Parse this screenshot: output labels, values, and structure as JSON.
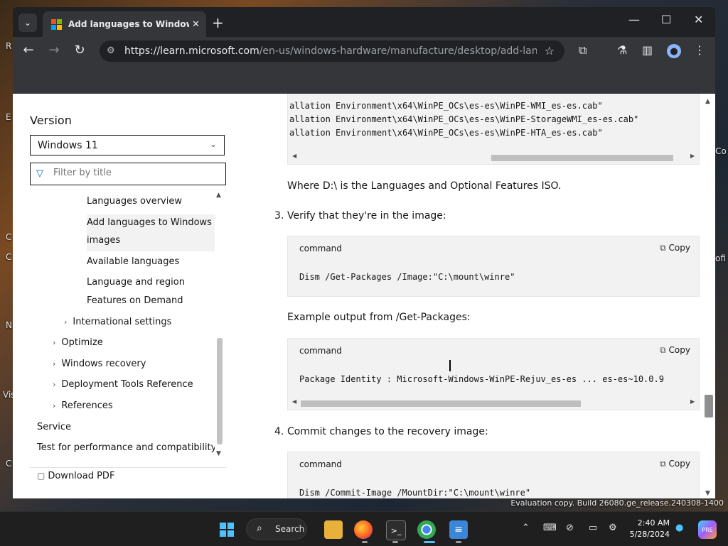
{
  "desktop": {
    "edge_texts": [
      "R",
      "E",
      "C",
      "N",
      "Vis",
      "C",
      "C",
      "Co",
      "ofi"
    ],
    "watermark": "Evaluation copy. Build 26080.ge_release.240308-1400"
  },
  "browser": {
    "tab_title": "Add languages to Windows im",
    "tab_close": "✕",
    "new_tab": "+",
    "url_domain": "https://learn.microsoft.com",
    "url_path": "/en-us/windows-hardware/manufacture/desktop/add-language-...",
    "icons": {
      "tab_menu": "chevron-down-icon",
      "back": "←",
      "forward": "→",
      "reload": "↻",
      "star": "☆",
      "minimize": "—",
      "maximize": "☐",
      "close": "✕"
    }
  },
  "sidebar": {
    "version_label": "Version",
    "version_value": "Windows 11",
    "filter_placeholder": "Filter by title",
    "toc": [
      {
        "label": "Languages overview"
      },
      {
        "label": "Add languages to Windows"
      },
      {
        "label": "images"
      },
      {
        "label": "Available languages"
      },
      {
        "label": "Language and region"
      },
      {
        "label": "Features on Demand"
      },
      {
        "label": "International settings"
      },
      {
        "label": "Optimize"
      },
      {
        "label": "Windows recovery"
      },
      {
        "label": "Deployment Tools Reference"
      },
      {
        "label": "References"
      },
      {
        "label": "Service"
      },
      {
        "label": "Test for performance and compatibility"
      }
    ],
    "download_pdf": "Download PDF"
  },
  "content": {
    "top_code_lines": [
      "allation Environment\\x64\\WinPE_OCs\\es-es\\WinPE-WMI_es-es.cab\"",
      "allation Environment\\x64\\WinPE_OCs\\es-es\\WinPE-StorageWMI_es-es.cab\"",
      "allation Environment\\x64\\WinPE_OCs\\es-es\\WinPE-HTA_es-es.cab\""
    ],
    "where_text": "Where D:\\ is the Languages and Optional Features ISO.",
    "step3_num": "3.",
    "step3_text": "Verify that they're in the image:",
    "block_lang": "command",
    "copy_label": "Copy",
    "cmd1": "Dism /Get-Packages /Image:\"C:\\mount\\winre\"",
    "example_text": "Example output from /Get-Packages:",
    "cmd2": "Package Identity : Microsoft-Windows-WinPE-Rejuv_es-es ... es-es~10.0.9",
    "step4_num": "4.",
    "step4_text": "Commit changes to the recovery image:",
    "cmd3": "Dism /Commit-Image /MountDir:\"C:\\mount\\winre\""
  },
  "taskbar": {
    "search_label": "Search",
    "time": "2:40 AM",
    "date": "5/28/2024",
    "apps": [
      "windows-start-icon",
      "file-explorer-icon",
      "firefox-icon",
      "terminal-icon",
      "chrome-icon",
      "notepad-icon"
    ],
    "tray_icons": [
      "chevron-up-icon",
      "keyboard-icon",
      "network-off-icon",
      "display-icon",
      "settings-icon",
      "bell-icon",
      "copilot-icon"
    ],
    "colors": {
      "accent": "#0067b8",
      "taskbar": "#1f1f1f"
    }
  }
}
